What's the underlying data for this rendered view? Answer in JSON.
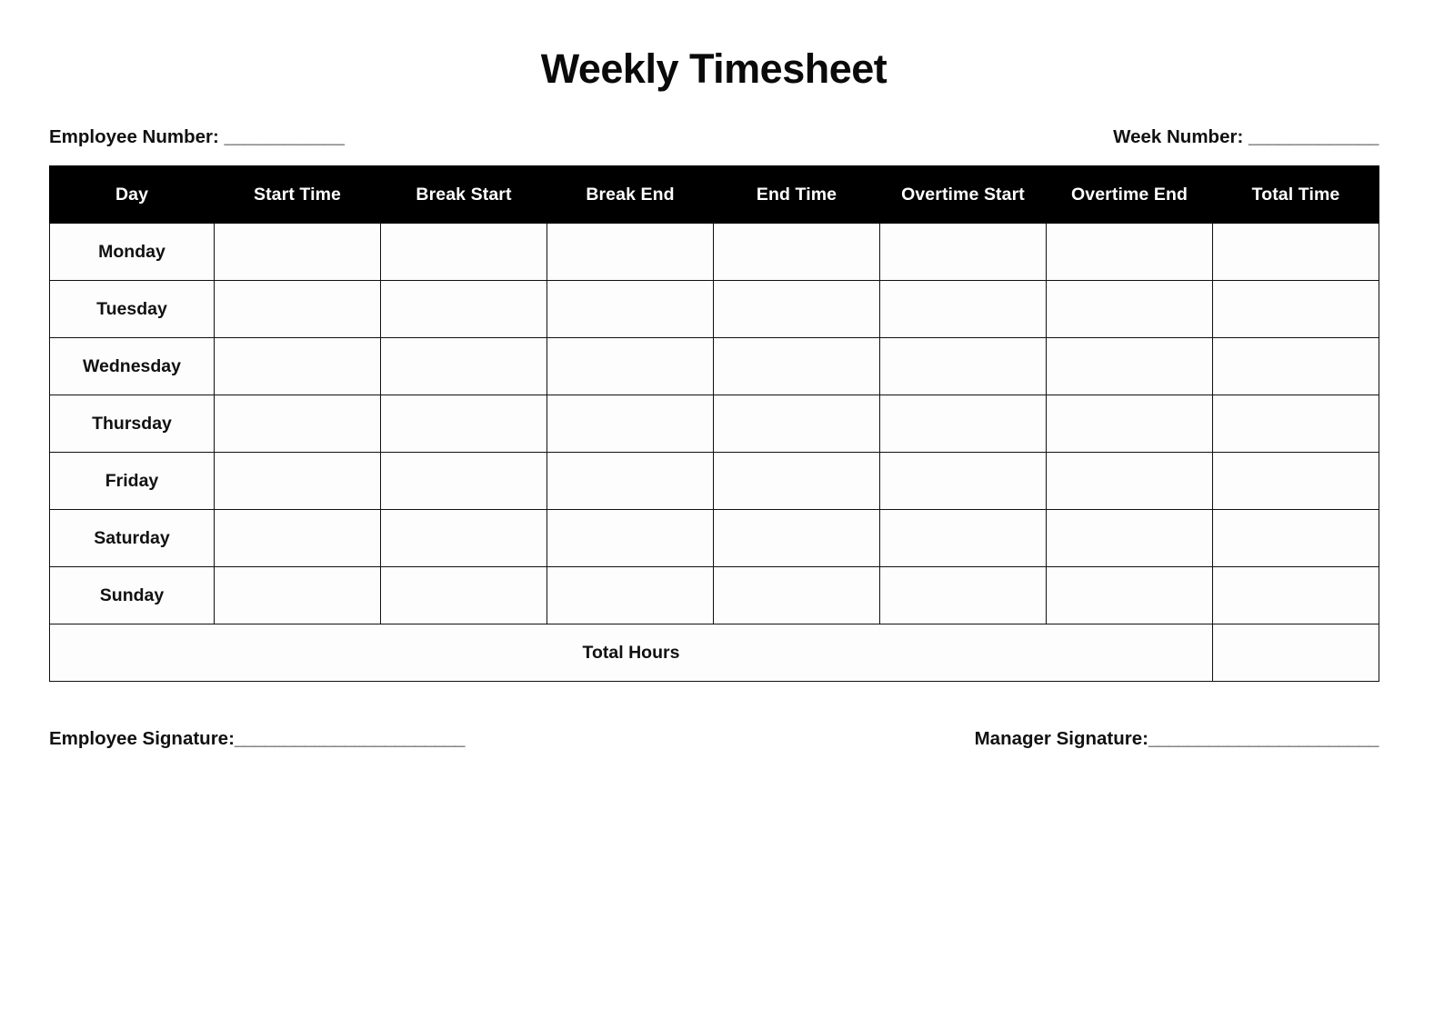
{
  "document": {
    "title": "Weekly Timesheet",
    "page_background": "#ffffff",
    "header_background": "#000000",
    "header_text_color": "#ffffff",
    "border_color": "#101010"
  },
  "meta": {
    "employee_number_label": "Employee Number: ",
    "employee_number_blank": "____________",
    "week_number_label": "Week Number: ",
    "week_number_blank": "_____________"
  },
  "table": {
    "columns": [
      "Day",
      "Start Time",
      "Break Start",
      "Break End",
      "End Time",
      "Overtime Start",
      "Overtime End",
      "Total Time"
    ],
    "rows": [
      {
        "day": "Monday",
        "start_time": "",
        "break_start": "",
        "break_end": "",
        "end_time": "",
        "overtime_start": "",
        "overtime_end": "",
        "total_time": ""
      },
      {
        "day": "Tuesday",
        "start_time": "",
        "break_start": "",
        "break_end": "",
        "end_time": "",
        "overtime_start": "",
        "overtime_end": "",
        "total_time": ""
      },
      {
        "day": "Wednesday",
        "start_time": "",
        "break_start": "",
        "break_end": "",
        "end_time": "",
        "overtime_start": "",
        "overtime_end": "",
        "total_time": ""
      },
      {
        "day": "Thursday",
        "start_time": "",
        "break_start": "",
        "break_end": "",
        "end_time": "",
        "overtime_start": "",
        "overtime_end": "",
        "total_time": ""
      },
      {
        "day": "Friday",
        "start_time": "",
        "break_start": "",
        "break_end": "",
        "end_time": "",
        "overtime_start": "",
        "overtime_end": "",
        "total_time": ""
      },
      {
        "day": "Saturday",
        "start_time": "",
        "break_start": "",
        "break_end": "",
        "end_time": "",
        "overtime_start": "",
        "overtime_end": "",
        "total_time": ""
      },
      {
        "day": "Sunday",
        "start_time": "",
        "break_start": "",
        "break_end": "",
        "end_time": "",
        "overtime_start": "",
        "overtime_end": "",
        "total_time": ""
      }
    ],
    "total_row": {
      "label": "Total Hours",
      "value": ""
    }
  },
  "signatures": {
    "employee_label": "Employee Signature:",
    "employee_blank": "_______________________",
    "manager_label": "Manager Signature:",
    "manager_blank": "_______________________"
  }
}
